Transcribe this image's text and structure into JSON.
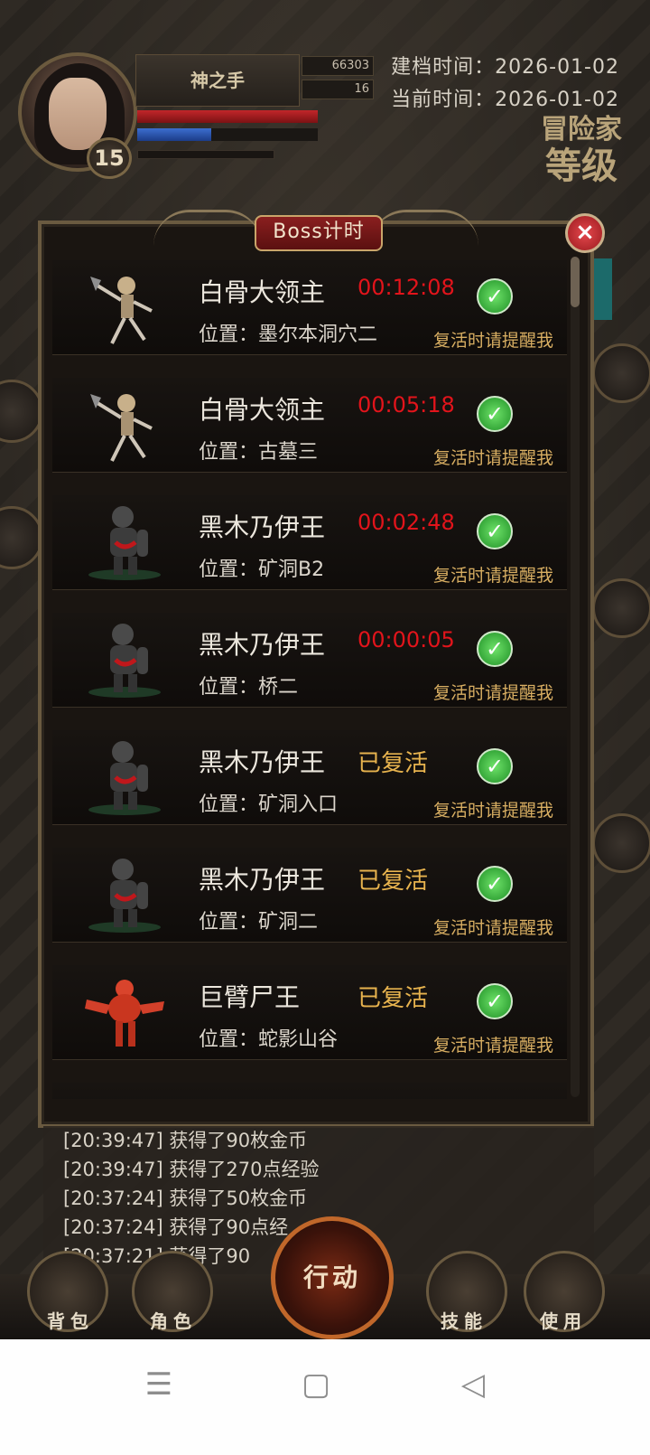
{
  "player": {
    "name": "神之手",
    "level": "15",
    "gold": "66303",
    "gems": "16"
  },
  "times": {
    "created_label": "建档时间：",
    "created": "2026-01-02",
    "now_label": "当前时间：",
    "now": "2026-01-02"
  },
  "adventurer_title": [
    "冒险家",
    "等级"
  ],
  "panel": {
    "title": "Boss计时",
    "close_icon": "×"
  },
  "bosses": [
    {
      "name": "白骨大领主",
      "status": "00:12:08",
      "location": "位置：墨尔本洞穴二",
      "remind": "复活时请提醒我",
      "revived": false,
      "type": "skeleton"
    },
    {
      "name": "白骨大领主",
      "status": "00:05:18",
      "location": "位置：古墓三",
      "remind": "复活时请提醒我",
      "revived": false,
      "type": "skeleton"
    },
    {
      "name": "黑木乃伊王",
      "status": "00:02:48",
      "location": "位置：矿洞B2",
      "remind": "复活时请提醒我",
      "revived": false,
      "type": "mummy"
    },
    {
      "name": "黑木乃伊王",
      "status": "00:00:05",
      "location": "位置：桥二",
      "remind": "复活时请提醒我",
      "revived": false,
      "type": "mummy"
    },
    {
      "name": "黑木乃伊王",
      "status": "已复活",
      "location": "位置：矿洞入口",
      "remind": "复活时请提醒我",
      "revived": true,
      "type": "mummy"
    },
    {
      "name": "黑木乃伊王",
      "status": "已复活",
      "location": "位置：矿洞二",
      "remind": "复活时请提醒我",
      "revived": true,
      "type": "mummy"
    },
    {
      "name": "巨臂尸王",
      "status": "已复活",
      "location": "位置：蛇影山谷",
      "remind": "复活时请提醒我",
      "revived": true,
      "type": "red-giant"
    }
  ],
  "log": [
    "[20:39:47] 获得了90枚金币",
    "[20:39:47] 获得了270点经验",
    "[20:37:24] 获得了50枚金币",
    "[20:37:24] 获得了90点经",
    "[20:37:21] 获得了90"
  ],
  "bottom_nav": {
    "bag": "背包",
    "role": "角色",
    "action": "行动",
    "skill": "技能",
    "use": "使用"
  },
  "system_nav": {
    "menu_icon": "☰",
    "home_icon": "▢",
    "back_icon": "◁"
  },
  "colors": {
    "timer": "#e2141b",
    "revived": "#e7b34e",
    "remind": "#d8ae62",
    "check": "#2ea83a"
  }
}
